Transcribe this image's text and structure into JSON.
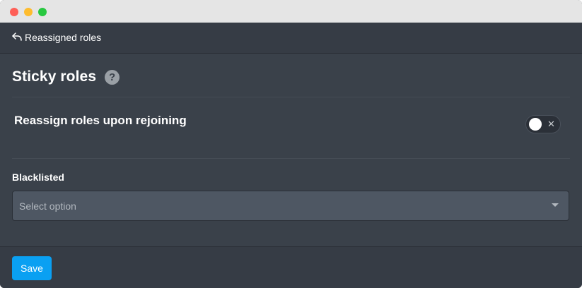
{
  "nav": {
    "back_label": "Reassigned roles"
  },
  "section": {
    "title": "Sticky roles",
    "help_icon": "?"
  },
  "settings": {
    "reassign": {
      "label": "Reassign roles upon rejoining",
      "enabled": false,
      "toggle_off_glyph": "✕"
    }
  },
  "blacklisted": {
    "label": "Blacklisted",
    "placeholder": "Select option"
  },
  "footer": {
    "save_label": "Save"
  },
  "colors": {
    "accent": "#0aa0f2",
    "panel": "#3a414a",
    "background": "#363c45"
  }
}
